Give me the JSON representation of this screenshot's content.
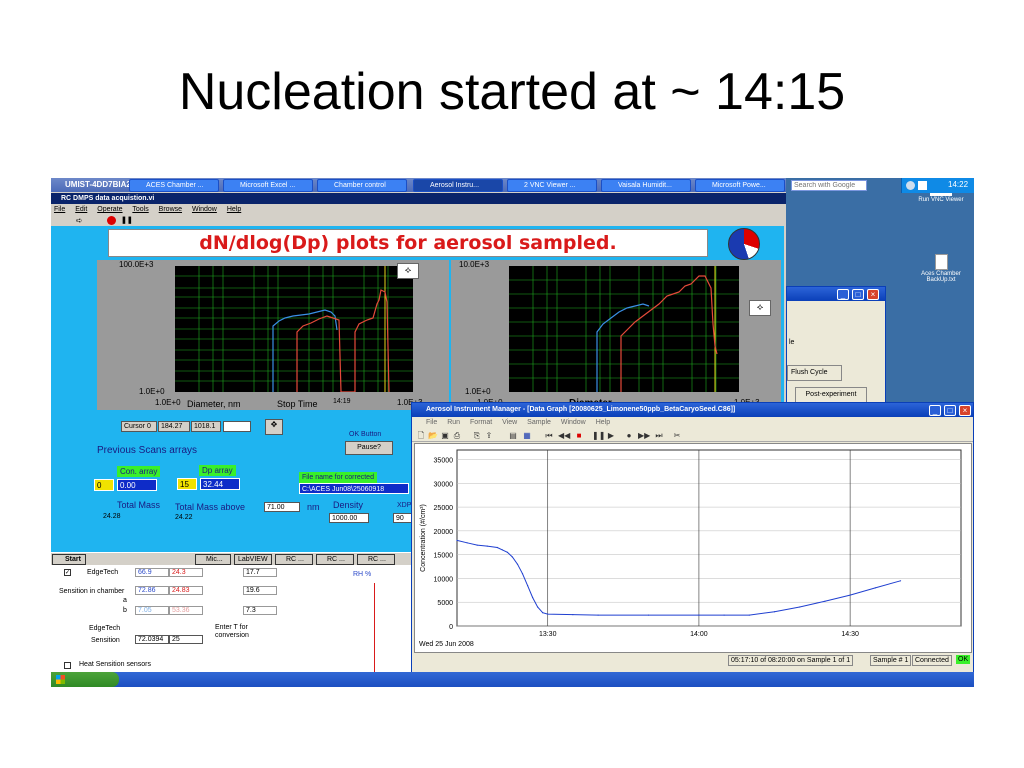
{
  "slide": {
    "title": "Nucleation started at ~ 14:15"
  },
  "vnc_window": {
    "title": "UMIST-4DD7BIA221",
    "app_title": "RC DMPS data acquistion.vi",
    "menu": [
      "File",
      "Edit",
      "Operate",
      "Tools",
      "Browse",
      "Window",
      "Help"
    ]
  },
  "labview": {
    "banner": "dN/dlog(Dp) plots for aerosol sampled.",
    "plot_left": {
      "y_top": "100.0E+3",
      "y_bottom": "1.0E+0",
      "x_left": "1.0E+0",
      "x_right": "1.0E+3",
      "xlabel": "Diameter, nm",
      "stop_label": "Stop Time",
      "stop_time": "14:19"
    },
    "plot_right": {
      "y_top": "10.0E+3",
      "y_bottom": "1.0E+0",
      "x_left": "1.0E+0",
      "x_right": "1.0E+3",
      "xlabel": "Diameter"
    },
    "cursor": {
      "label": "Cursor 0",
      "x": "184.27",
      "y": "1018.1"
    },
    "ok_button_label": "OK Button",
    "pause_button": "Pause?",
    "prev_scans": "Previous Scans arrays",
    "con_array_label": "Con. array",
    "con_array_index": "0",
    "con_array_value": "0.00",
    "dp_array_label": "Dp array",
    "dp_array_index": "15",
    "dp_array_value": "32.44",
    "file_name_label": "File name for corrected",
    "file_name_value": "C:\\ACES Jun08\\25060918",
    "total_mass_label": "Total Mass",
    "total_mass_value": "24.28",
    "total_mass_above_label": "Total Mass above",
    "total_mass_above_threshold": "71.00",
    "total_mass_above_unit": "nm",
    "total_mass_above_value": "24.22",
    "density_label": "Density",
    "density_value": "1000.00",
    "xdp_label": "XDP",
    "xdp_value": "90"
  },
  "vnc_taskbar": {
    "start": "Start",
    "items": [
      "Mic...",
      "LabVIEW",
      "RC ...",
      "RC ...",
      "RC ..."
    ]
  },
  "excel": {
    "rows": [
      {
        "label": "EdgeTech",
        "v1": "66.9",
        "v2": "24.3",
        "v3": "17.7"
      },
      {
        "label": "Sensition in chamber",
        "v1": "72.86",
        "v2": "24.83",
        "v3": "19.6"
      },
      {
        "label": "a",
        "v1": "",
        "v2": "",
        "v3": ""
      },
      {
        "label": "b",
        "v1": "7.05",
        "v2": "53.36",
        "v3": "7.3"
      }
    ],
    "edgetech_label": "EdgeTech",
    "sensition_label": "Sensition",
    "sensition_v1": "72.0394",
    "sensition_v2": "25",
    "enter_t_label": "Enter T for conversion",
    "rh_label": "RH %",
    "heat_label": "Heat Sensition sensors"
  },
  "chamber_control": {
    "flush_cycle": "Flush Cycle",
    "post_experiment": "Post-experiment",
    "partial_label": "le"
  },
  "desktop": {
    "vnc_icon_label": "Run VNC Viewer",
    "vnc_icon_glyph": "V2",
    "file_icon_label": "Aces Chamber BackUp.txt"
  },
  "aim": {
    "title": "Aerosol Instrument Manager - [Data Graph  [20080625_Limonene50ppb_BetaCaryoSeed.C86]]",
    "menu": [
      "File",
      "Run",
      "Format",
      "View",
      "Sample",
      "Window",
      "Help"
    ],
    "date_label": "Wed 25 Jun 2008",
    "status_time": "05:17:10 of 08:20:00 on Sample 1 of 1",
    "status_sample": "Sample # 1",
    "status_connected": "Connected",
    "status_ok": "OK"
  },
  "chart_data": {
    "type": "line",
    "title": "",
    "xlabel": "",
    "ylabel": "Concentration (#/cm³)",
    "x_ticks": [
      "13:30",
      "14:00",
      "14:30"
    ],
    "y_ticks": [
      0,
      5000,
      10000,
      15000,
      20000,
      25000,
      30000,
      35000
    ],
    "ylim": [
      0,
      37000
    ],
    "grid": true,
    "series": [
      {
        "color": "#1f3fd0",
        "x": [
          "13:12",
          "13:14",
          "13:16",
          "13:18",
          "13:20",
          "13:21",
          "13:22",
          "13:23",
          "13:24",
          "13:25",
          "13:26",
          "13:27",
          "13:28",
          "13:29",
          "13:30",
          "13:35",
          "13:40",
          "13:50",
          "14:00",
          "14:05",
          "14:10",
          "14:15",
          "14:20",
          "14:25",
          "14:30",
          "14:35",
          "14:40"
        ],
        "y": [
          18000,
          17500,
          17000,
          16800,
          16500,
          16000,
          15500,
          14500,
          13000,
          11000,
          8500,
          6000,
          4000,
          2800,
          2500,
          2400,
          2300,
          2300,
          2300,
          2300,
          2300,
          3000,
          4000,
          5200,
          6500,
          8000,
          9500
        ]
      }
    ]
  },
  "xp_taskbar": {
    "start": "start",
    "items": [
      "ACES Chamber ...",
      "Microsoft Excel ...",
      "Chamber control",
      "Aerosol Instru...",
      "2 VNC Viewer ...",
      "Vaisala Humidit...",
      "Microsoft Powe..."
    ],
    "search_placeholder": "Search with Google",
    "clock": "14:22"
  },
  "colors": {
    "labview_bg": "#1fb4f0",
    "labview_banner_text": "#d91a1a",
    "series_blue": "#3a8fe6",
    "series_red": "#e64a3a",
    "plot_grid": "#1fb01f",
    "xp_start": "#3c9a2b"
  }
}
